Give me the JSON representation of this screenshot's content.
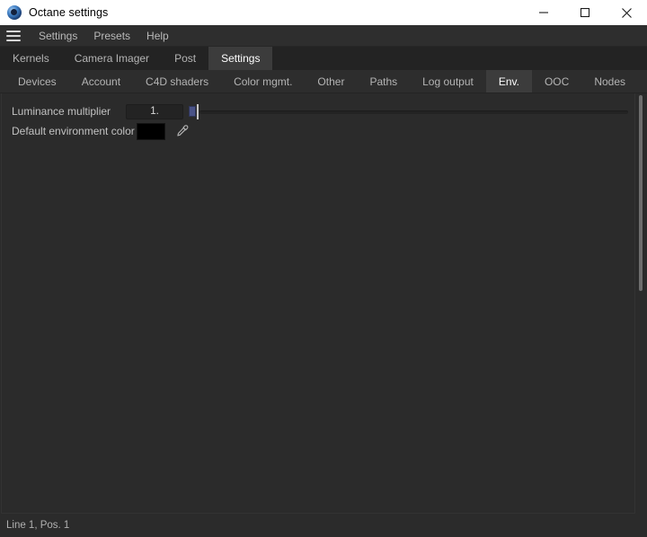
{
  "window": {
    "title": "Octane settings",
    "logo_icon": "octane-sphere-logo",
    "controls": {
      "minimize_icon": "minimize-icon",
      "maximize_icon": "maximize-icon",
      "close_icon": "close-icon"
    }
  },
  "menubar": {
    "hamburger_icon": "hamburger-menu-icon",
    "items": [
      {
        "label": "Settings"
      },
      {
        "label": "Presets"
      },
      {
        "label": "Help"
      }
    ]
  },
  "tabs": {
    "main": [
      {
        "label": "Kernels",
        "active": false
      },
      {
        "label": "Camera Imager",
        "active": false
      },
      {
        "label": "Post",
        "active": false
      },
      {
        "label": "Settings",
        "active": true
      }
    ],
    "sub": [
      {
        "label": "Devices",
        "active": false
      },
      {
        "label": "Account",
        "active": false
      },
      {
        "label": "C4D shaders",
        "active": false
      },
      {
        "label": "Color mgmt.",
        "active": false
      },
      {
        "label": "Other",
        "active": false
      },
      {
        "label": "Paths",
        "active": false
      },
      {
        "label": "Log output",
        "active": false
      },
      {
        "label": "Env.",
        "active": true
      },
      {
        "label": "OOC",
        "active": false
      },
      {
        "label": "Nodes",
        "active": false
      }
    ]
  },
  "settings": {
    "luminance_multiplier": {
      "label": "Luminance multiplier",
      "value": "1.",
      "slider_position_percent": 0
    },
    "default_environment_color": {
      "label": "Default environment color",
      "swatch_color": "#000000",
      "picker_icon": "eyedropper-icon"
    }
  },
  "statusbar": {
    "text": "Line 1, Pos. 1"
  },
  "theme": {
    "titlebar_bg": "#ffffff",
    "titlebar_text": "#000000",
    "app_bg": "#2b2b2b",
    "panel_bg": "#2b2b2b",
    "tab_bg": "#232323",
    "tab_active_bg": "#3c3c3c",
    "subtab_bg": "#2d2d2d",
    "text": "#b4b4b4",
    "text_active": "#ffffff",
    "slider_handle": "#4a5387"
  }
}
